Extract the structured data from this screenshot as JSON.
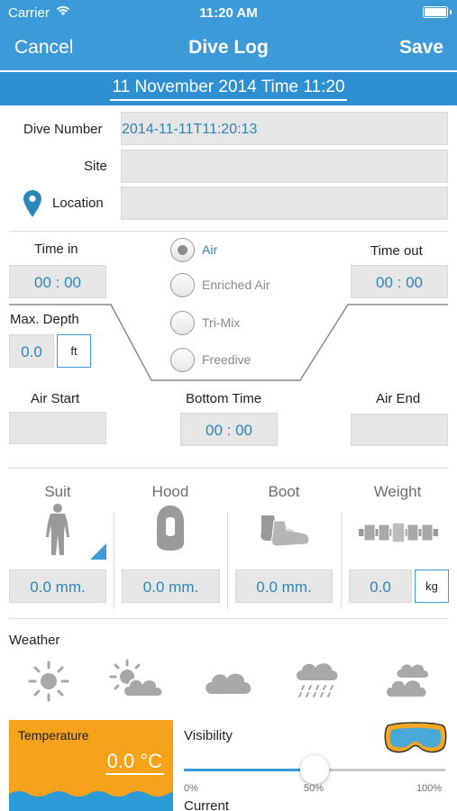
{
  "status_bar": {
    "carrier": "Carrier",
    "time": "11:20 AM"
  },
  "nav": {
    "cancel": "Cancel",
    "title": "Dive Log",
    "save": "Save"
  },
  "date_header": "11 November 2014 Time 11:20",
  "dive_info": {
    "dive_number_label": "Dive Number",
    "dive_number_value": "2014-11-11T11:20:13",
    "site_label": "Site",
    "site_value": "",
    "location_label": "Location",
    "location_value": ""
  },
  "profile": {
    "time_in_label": "Time in",
    "time_in_value": "00 : 00",
    "time_out_label": "Time out",
    "time_out_value": "00 : 00",
    "max_depth_label": "Max. Depth",
    "max_depth_value": "0.0",
    "depth_unit": "ft",
    "gas_options": [
      "Air",
      "Enriched Air",
      "Tri-Mix",
      "Freedive"
    ],
    "selected_gas": "Air",
    "air_start_label": "Air Start",
    "air_start_value": "",
    "bottom_time_label": "Bottom Time",
    "bottom_time_value": "00 : 00",
    "air_end_label": "Air End",
    "air_end_value": ""
  },
  "gear": {
    "suit_label": "Suit",
    "suit_value": "0.0 mm.",
    "suit_icon": "wetsuit-icon",
    "hood_label": "Hood",
    "hood_value": "0.0 mm.",
    "hood_icon": "hood-icon",
    "boot_label": "Boot",
    "boot_value": "0.0 mm.",
    "boot_icon": "boot-icon",
    "weight_label": "Weight",
    "weight_value": "0.0",
    "weight_unit": "kg",
    "weight_icon": "weight-belt-icon"
  },
  "weather": {
    "label": "Weather",
    "icons": [
      "sunny-icon",
      "partly-cloudy-icon",
      "cloudy-icon",
      "rain-icon",
      "overcast-icon"
    ]
  },
  "temperature": {
    "label": "Temperature",
    "value": "0.0 °C"
  },
  "visibility": {
    "label": "Visibility",
    "level": 0.5,
    "ticks": [
      "0%",
      "50%",
      "100%"
    ],
    "icon": "goggles-icon"
  },
  "current": {
    "label": "Current"
  },
  "colors": {
    "accent": "#3d9ad8",
    "value_text": "#2c87b9",
    "temperature_bg": "#f7a21b",
    "water": "#2c9ad6",
    "goggle_frame": "#f5a623",
    "goggle_lens": "#4aa8d8"
  }
}
